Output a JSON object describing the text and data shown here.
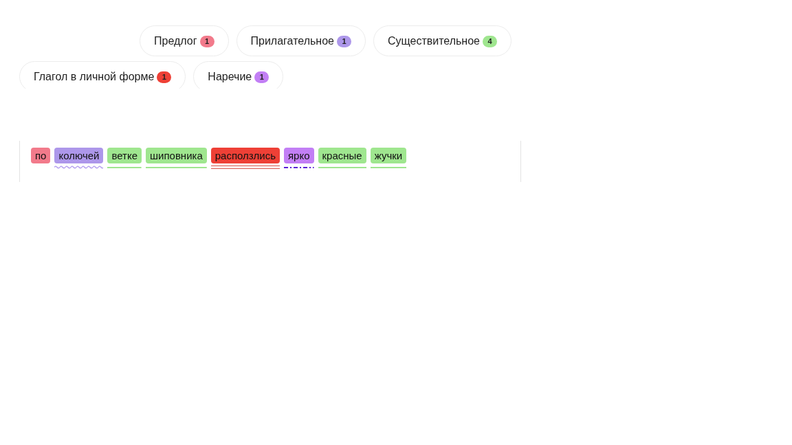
{
  "legend_rows": [
    [
      {
        "label": "Предлог",
        "count": "1",
        "color": "#f27a8b"
      },
      {
        "label": "Прилагательное",
        "count": "1",
        "color": "#ad97ea"
      },
      {
        "label": "Существительное",
        "count": "4",
        "color": "#9fe68f"
      }
    ],
    [
      {
        "label": "Глагол в личной форме",
        "count": "1",
        "color": "#ee4036"
      },
      {
        "label": "Наречие",
        "count": "1",
        "color": "#c27ff5"
      }
    ]
  ],
  "sentence": {
    "words": [
      {
        "text": "по",
        "color": "#f27a8b"
      },
      {
        "text": "колючей",
        "color": "#ad97ea",
        "underline": {
          "kind": "wavy",
          "color": "#b59ff0"
        }
      },
      {
        "text": "ветке",
        "color": "#9fe68f",
        "underline": {
          "kind": "solid",
          "color": "#9fe68f"
        }
      },
      {
        "text": "шиповника",
        "color": "#9fe68f",
        "underline": {
          "kind": "solid",
          "color": "#9fe68f"
        }
      },
      {
        "text": "расползлись",
        "color": "#ee4036",
        "underline": {
          "kind": "double",
          "color": "#d9564d"
        }
      },
      {
        "text": "ярко",
        "color": "#c27ff5",
        "underline": {
          "kind": "dash-dot",
          "color": "#5a1fd6"
        }
      },
      {
        "text": "красные",
        "color": "#9fe68f",
        "underline": {
          "kind": "solid",
          "color": "#9fe68f"
        }
      },
      {
        "text": "жучки",
        "color": "#9fe68f",
        "underline": {
          "kind": "solid",
          "color": "#9fe68f"
        }
      }
    ]
  }
}
